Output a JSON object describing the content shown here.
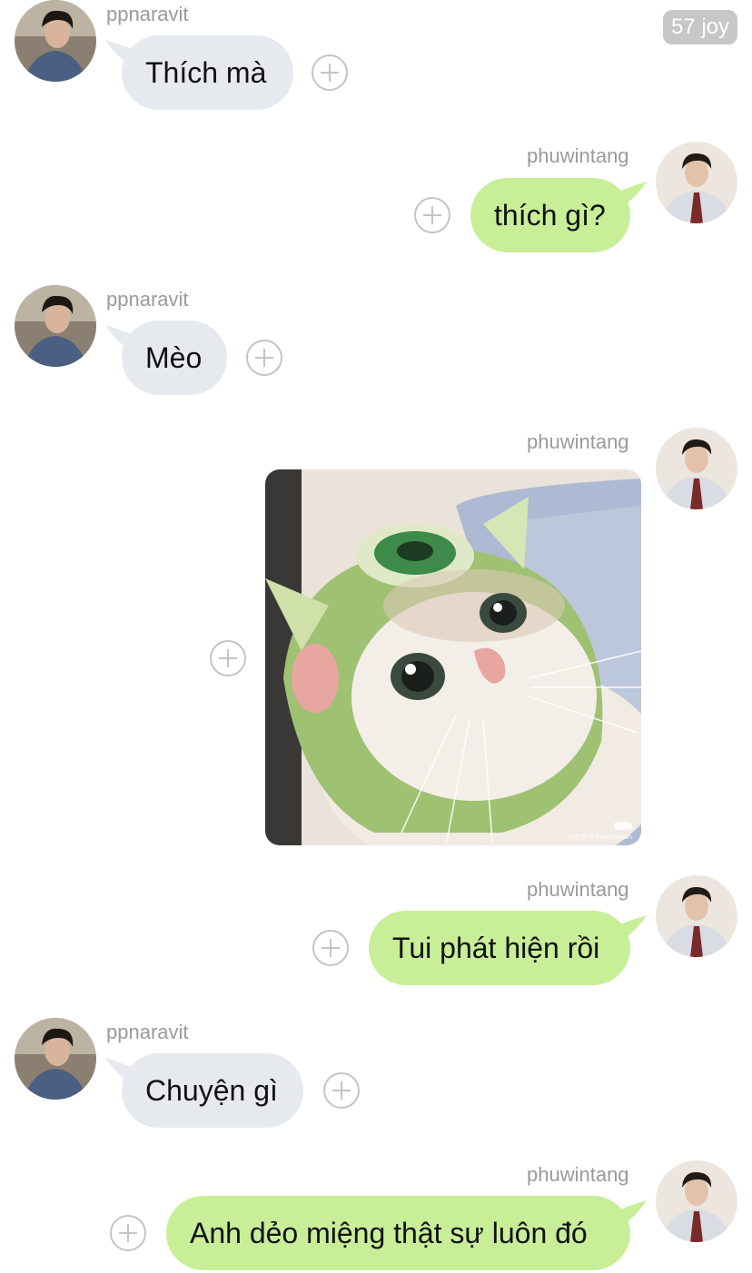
{
  "header": {
    "badge": "57 joy"
  },
  "users": {
    "incoming": {
      "name": "ppnaravit",
      "avatar_icon": "user-avatar-curly-hair"
    },
    "outgoing": {
      "name": "phuwintang",
      "avatar_icon": "user-avatar-shirt-tie"
    }
  },
  "colors": {
    "incoming_bubble": "#e6e9ee",
    "outgoing_bubble": "#c8ef98",
    "name_text": "#9a9a9a",
    "reaction_icon": "#c4c4c4"
  },
  "messages": [
    {
      "sender": "ppnaravit",
      "text": "Thích mà"
    },
    {
      "sender": "phuwintang",
      "text": "thích gì?"
    },
    {
      "sender": "ppnaravit",
      "text": "Mèo"
    },
    {
      "sender": "phuwintang",
      "type": "image",
      "image_icon": "cat-in-green-monster-hat-photo",
      "watermark": "小红书号 Catcattown"
    },
    {
      "sender": "phuwintang",
      "text": "Tui phát hiện rồi"
    },
    {
      "sender": "ppnaravit",
      "text": "Chuyện gì"
    },
    {
      "sender": "phuwintang",
      "text": "Anh dẻo miệng thật sự luôn đó"
    }
  ]
}
